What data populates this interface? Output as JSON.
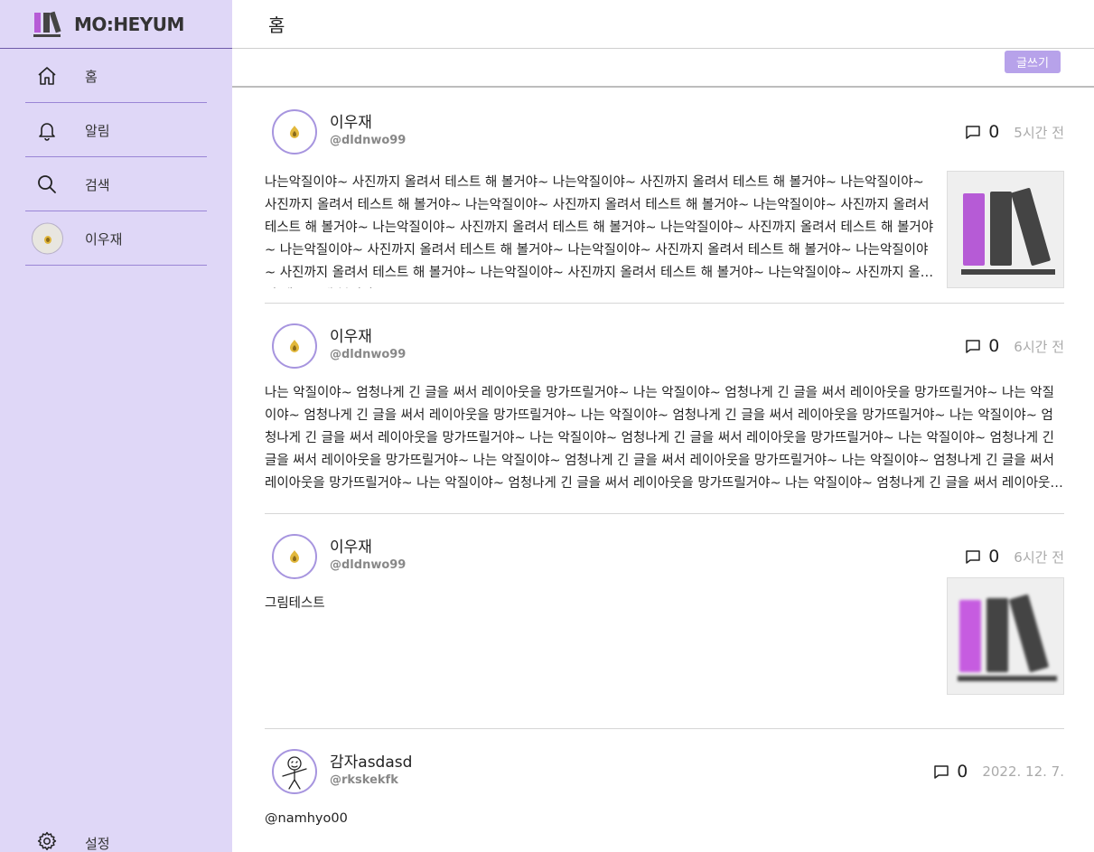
{
  "brand": {
    "name": "MO:HEYUM",
    "logo_icon": "books-logo"
  },
  "sidebar": {
    "items": [
      {
        "label": "홈",
        "icon": "home-icon"
      },
      {
        "label": "알림",
        "icon": "bell-icon"
      },
      {
        "label": "검색",
        "icon": "search-icon"
      },
      {
        "label": "이우재",
        "icon": "avatar"
      }
    ],
    "settings_label": "설정"
  },
  "header": {
    "title": "홈"
  },
  "toolbar": {
    "write_label": "글쓰기"
  },
  "posts": [
    {
      "author": "이우재",
      "handle": "@dldnwo99",
      "comments": "0",
      "time": "5시간 전",
      "text": "나는악질이야~ 사진까지 올려서 테스트 해 볼거야~ 나는악질이야~ 사진까지 올려서 테스트 해 볼거야~ 나는악질이야~ 사진까지 올려서 테스트 해 볼거야~ 나는악질이야~ 사진까지 올려서 테스트 해 볼거야~ 나는악질이야~ 사진까지 올려서 테스트 해 볼거야~ 나는악질이야~ 사진까지 올려서 테스트 해 볼거야~ 나는악질이야~ 사진까지 올려서 테스트 해 볼거야~ 나는악질이야~ 사진까지 올려서 테스트 해 볼거야~ 나는악질이야~ 사진까지 올려서 테스트 해 볼거야~ 나는악질이야~ 사진까지 올려서 테스트 해 볼거야~ 나는악질이야~ 사진까지 올려서 테스트 해 볼거야~ 나는악질이야~ 사진까지 올려서 테스트 해 볼거야~"
    },
    {
      "author": "이우재",
      "handle": "@dldnwo99",
      "comments": "0",
      "time": "6시간 전",
      "text": "나는 악질이야~ 엄청나게 긴 글을 써서 레이아웃을 망가뜨릴거야~ 나는 악질이야~ 엄청나게 긴 글을 써서 레이아웃을 망가뜨릴거야~ 나는 악질이야~ 엄청나게 긴 글을 써서 레이아웃을 망가뜨릴거야~ 나는 악질이야~ 엄청나게 긴 글을 써서 레이아웃을 망가뜨릴거야~ 나는 악질이야~ 엄청나게 긴 글을 써서 레이아웃을 망가뜨릴거야~ 나는 악질이야~ 엄청나게 긴 글을 써서 레이아웃을 망가뜨릴거야~ 나는 악질이야~ 엄청나게 긴 글을 써서 레이아웃을 망가뜨릴거야~ 나는 악질이야~ 엄청나게 긴 글을 써서 레이아웃을 망가뜨릴거야~ 나는 악질이야~ 엄청나게 긴 글을 써서 레이아웃을 망가뜨릴거야~ 나는 악질이야~ 엄청나게 긴 글을 써서 레이아웃을 망가뜨릴거야~ 나는 악질이야~ 엄청나게 긴 글을 써서 레이아웃을 망가뜨릴거야~"
    },
    {
      "author": "이우재",
      "handle": "@dldnwo99",
      "comments": "0",
      "time": "6시간 전",
      "text": "그림테스트"
    },
    {
      "author": "감자asdasd",
      "handle": "@rkskekfk",
      "comments": "0",
      "time": "2022. 12. 7.",
      "text": "@namhyo00"
    }
  ]
}
